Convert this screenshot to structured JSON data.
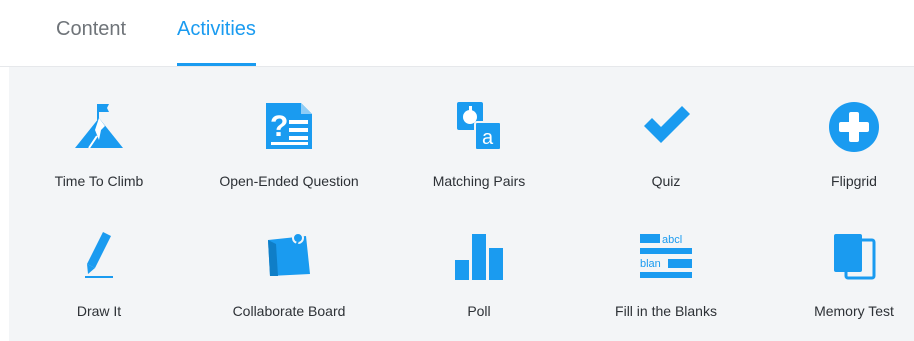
{
  "tabs": [
    {
      "label": "Content",
      "active": false
    },
    {
      "label": "Activities",
      "active": true
    }
  ],
  "accent_color": "#1a9bf0",
  "activities": [
    {
      "label": "Time To Climb",
      "icon": "mountain-flag-icon"
    },
    {
      "label": "Open-Ended Question",
      "icon": "question-document-icon"
    },
    {
      "label": "Matching Pairs",
      "icon": "matching-cards-icon"
    },
    {
      "label": "Quiz",
      "icon": "checkmark-icon"
    },
    {
      "label": "Flipgrid",
      "icon": "plus-circle-icon"
    },
    {
      "label": "Draw It",
      "icon": "pencil-icon"
    },
    {
      "label": "Collaborate Board",
      "icon": "pinned-board-icon"
    },
    {
      "label": "Poll",
      "icon": "bar-chart-icon"
    },
    {
      "label": "Fill in the Blanks",
      "icon": "fill-blanks-icon",
      "icon_text": [
        "abcl",
        "blan"
      ]
    },
    {
      "label": "Memory Test",
      "icon": "stacked-cards-icon"
    }
  ]
}
